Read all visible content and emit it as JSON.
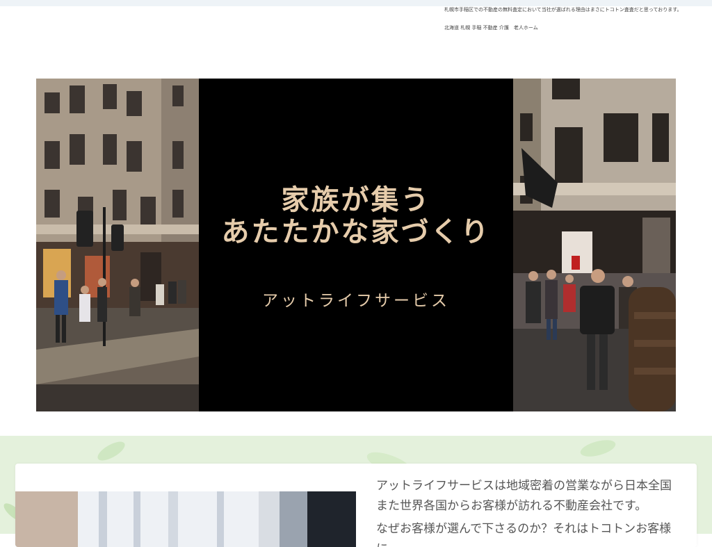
{
  "header": {
    "description": "札幌市手稲区での不動産の無料査定において当社が選ばれる理由はまさにトコトン査査だと思っております。",
    "tags": "北海道 札幌 手稲 不動産 介護　老人ホーム"
  },
  "hero": {
    "line1": "家族が集う",
    "line2": "あたたかな家づくり",
    "brand": "アットライフサービス"
  },
  "intro": {
    "paragraph1": "アットライフサービスは地域密着の営業ながら日本全国また世界各国からお客様が訪れる不動産会社です。",
    "paragraph2": "なぜお客様が選んで下さるのか？それはトコトンお客様に"
  },
  "colors": {
    "hero_text": "#e6ccab",
    "band_green": "#e4f1dc"
  }
}
